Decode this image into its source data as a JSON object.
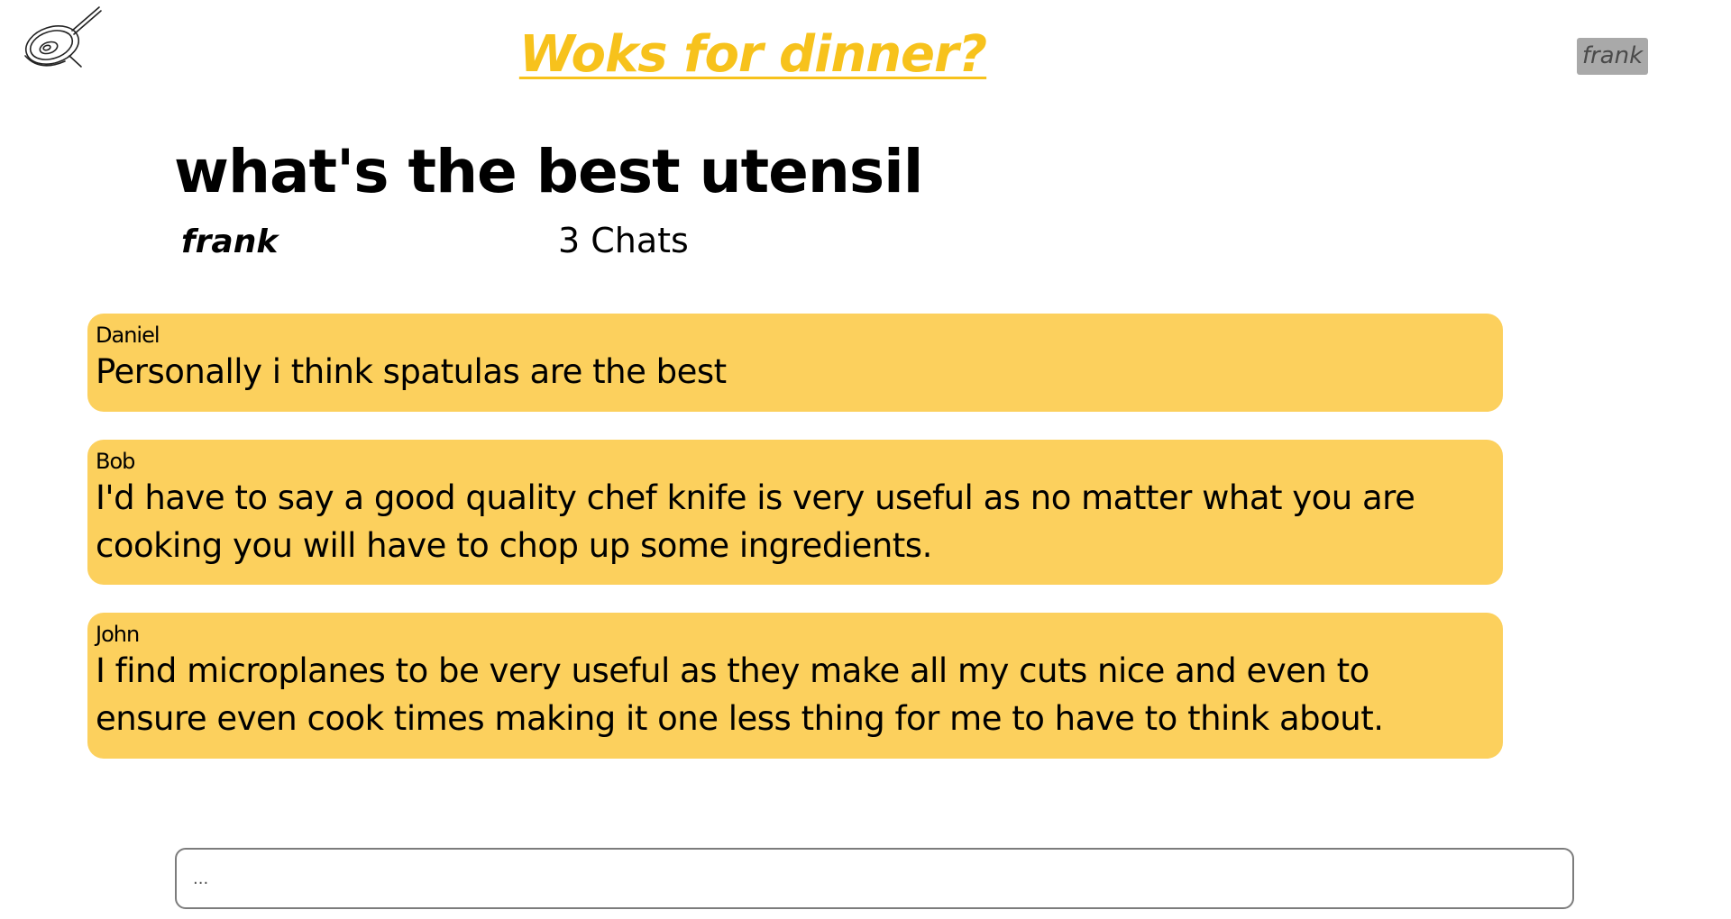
{
  "header": {
    "site_title": "Woks for dinner?",
    "user_chip": "frank",
    "logo_icon": "wok-icon"
  },
  "thread": {
    "title": "what's the best utensil",
    "author": "frank",
    "chat_count": "3 Chats"
  },
  "messages": [
    {
      "author": "Daniel",
      "text": "Personally i think spatulas are the best"
    },
    {
      "author": "Bob",
      "text": "I'd have to say a good quality chef knife is very useful as no matter what you are cooking you will have to chop up some ingredients."
    },
    {
      "author": "John",
      "text": "I find microplanes to be very useful as they make all my cuts nice and even to ensure even cook times making it one less thing for me to have to think about."
    }
  ],
  "composer": {
    "placeholder": "..."
  },
  "colors": {
    "accent": "#f7c21c",
    "card_background": "#fcd05d",
    "chip_background": "#a9a9a9"
  }
}
